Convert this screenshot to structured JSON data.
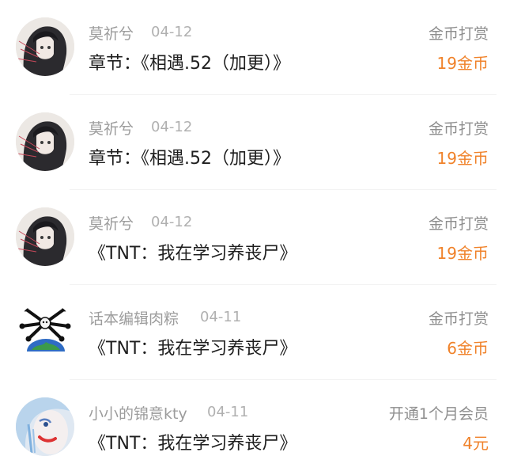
{
  "records": [
    {
      "user": "莫祈兮",
      "date": "04-12",
      "title": "章节：《相遇.52（加更）》",
      "type": "金币打赏",
      "amount": "19金币",
      "avatar": "anime-girl-avatar"
    },
    {
      "user": "莫祈兮",
      "date": "04-12",
      "title": "章节：《相遇.52（加更）》",
      "type": "金币打赏",
      "amount": "19金币",
      "avatar": "anime-girl-avatar"
    },
    {
      "user": "莫祈兮",
      "date": "04-12",
      "title": "《TNT：我在学习养丧尸》",
      "type": "金币打赏",
      "amount": "19金币",
      "avatar": "anime-girl-avatar"
    },
    {
      "user": "话本编辑肉粽",
      "date": "04-11",
      "title": "《TNT：我在学习养丧尸》",
      "type": "金币打赏",
      "amount": "6金币",
      "avatar": "earth-skull-avatar"
    },
    {
      "user": "小小的锦意kty",
      "date": "04-11",
      "title": "《TNT：我在学习养丧尸》",
      "type": "开通1个月会员",
      "amount": "4元",
      "avatar": "cosplay-portrait-avatar"
    }
  ],
  "colors": {
    "amount": "#f0822a",
    "name": "#9c9c9c",
    "title": "#1e1e1e"
  }
}
